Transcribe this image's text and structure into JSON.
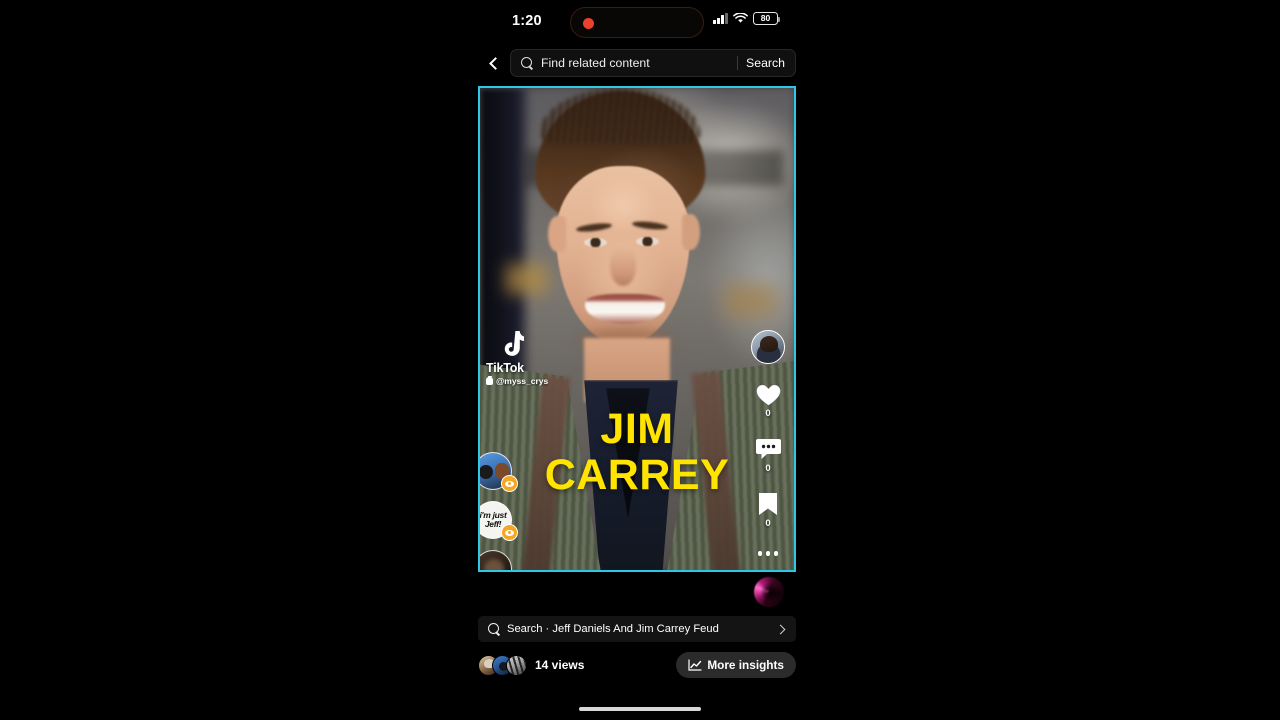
{
  "status_bar": {
    "time": "1:20",
    "battery_level": "80",
    "recording_indicator": "record-dot",
    "signal_icon": "cellular-bars-icon",
    "wifi_icon": "wifi-icon",
    "battery_icon": "battery-icon"
  },
  "top_bar": {
    "back_icon": "chevron-left-icon",
    "search_icon": "search-icon",
    "search_placeholder": "Find related content",
    "search_value": "",
    "search_button_label": "Search"
  },
  "video": {
    "border_color": "#2ec8e6",
    "overlay_title_line1": "JIM",
    "overlay_title_line2": "CARREY",
    "overlay_title_color": "#ffe400",
    "watermark": {
      "brand": "TikTok",
      "username": "@myss_crys",
      "note_icon": "tiktok-note-icon",
      "person_icon": "person-icon"
    },
    "rail": {
      "avatar": "creator-avatar",
      "like_icon": "heart-icon",
      "like_count": "0",
      "comment_icon": "comment-bubble-icon",
      "comment_count": "0",
      "bookmark_icon": "bookmark-icon",
      "bookmark_count": "0",
      "more_icon": "more-horizontal-icon"
    },
    "stickers": [
      {
        "name": "sticker-thumbnail-1",
        "label": "",
        "badge_icon": "eye-badge-icon"
      },
      {
        "name": "sticker-thumbnail-2",
        "label_line1": "i'm just",
        "label_line2": "Jeff!",
        "badge_icon": "eye-badge-icon"
      },
      {
        "name": "sticker-thumbnail-3",
        "label": "",
        "badge_icon": "eye-badge-icon"
      }
    ],
    "music_disc_icon": "music-disc-icon"
  },
  "suggestion": {
    "search_icon": "search-icon",
    "text": "Search · Jeff Daniels And Jim Carrey Feud",
    "chevron_icon": "chevron-right-icon"
  },
  "footer": {
    "viewer_avatars": [
      "viewer-avatar-1",
      "viewer-avatar-2",
      "viewer-avatar-3"
    ],
    "views_label": "14 views",
    "insights_icon": "line-chart-icon",
    "insights_label": "More insights"
  },
  "home_indicator": "home-indicator"
}
